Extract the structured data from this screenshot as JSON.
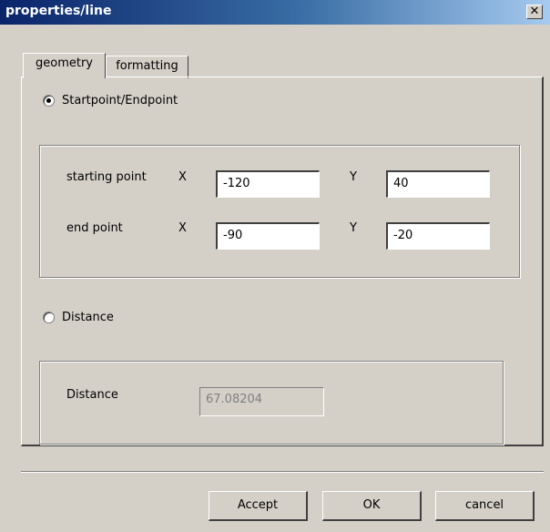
{
  "window": {
    "title": "properties/line",
    "close_glyph": "✕"
  },
  "tabs": [
    {
      "label": "geometry"
    },
    {
      "label": "formatting"
    }
  ],
  "geometry": {
    "mode_startend_label": "Startpoint/Endpoint",
    "mode_startend_selected": true,
    "starting_point": {
      "label": "starting point",
      "x_label": "X",
      "x": "-120",
      "y_label": "Y",
      "y": "40"
    },
    "end_point": {
      "label": "end point",
      "x_label": "X",
      "x": "-90",
      "y_label": "Y",
      "y": "-20"
    },
    "mode_distance_label": "Distance",
    "mode_distance_selected": false,
    "distance": {
      "label": "Distance",
      "value": "67.08204"
    }
  },
  "buttons": {
    "accept": "Accept",
    "ok": "OK",
    "cancel": "cancel"
  }
}
